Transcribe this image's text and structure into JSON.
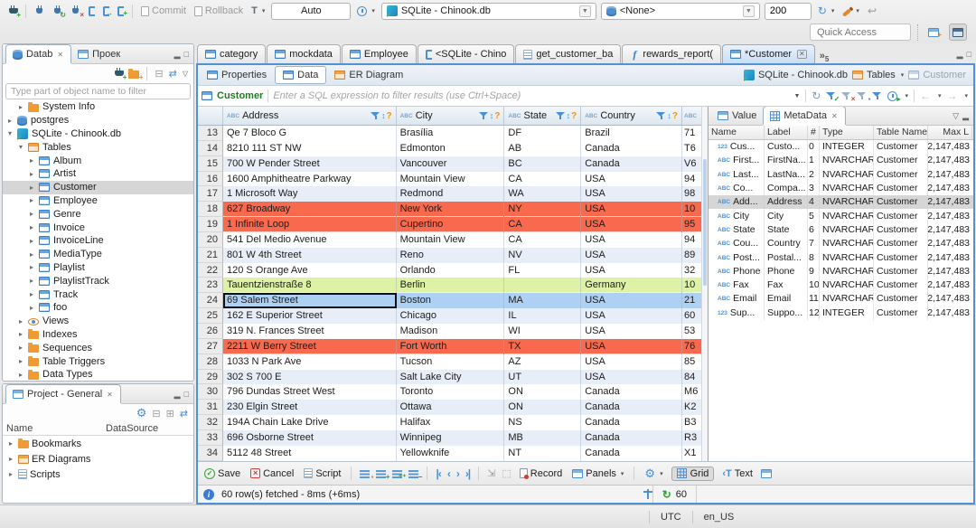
{
  "window": {
    "quick_access_placeholder": "Quick Access",
    "statusbar": {
      "timezone": "UTC",
      "locale": "en_US"
    }
  },
  "toolbar": {
    "commit_label": "Commit",
    "rollback_label": "Rollback",
    "tx_mode": "Auto",
    "connection": "SQLite - Chinook.db",
    "schema": "<None>",
    "fetch_size": "200"
  },
  "sidebar": {
    "tabs": [
      "Datab",
      "Проек"
    ],
    "filter_placeholder": "Type part of object name to filter",
    "tree": [
      {
        "label": "System Info",
        "icon": "folder",
        "indent": 1,
        "expanded": false
      },
      {
        "label": "postgres",
        "icon": "db",
        "indent": 0,
        "expanded": false
      },
      {
        "label": "SQLite - Chinook.db",
        "icon": "dbg",
        "indent": 0,
        "expanded": true
      },
      {
        "label": "Tables",
        "icon": "ftable",
        "indent": 1,
        "expanded": true
      },
      {
        "label": "Album",
        "icon": "table",
        "indent": 2,
        "expanded": false
      },
      {
        "label": "Artist",
        "icon": "table",
        "indent": 2,
        "expanded": false
      },
      {
        "label": "Customer",
        "icon": "table",
        "indent": 2,
        "expanded": false,
        "selected": true
      },
      {
        "label": "Employee",
        "icon": "table",
        "indent": 2,
        "expanded": false
      },
      {
        "label": "Genre",
        "icon": "table",
        "indent": 2,
        "expanded": false
      },
      {
        "label": "Invoice",
        "icon": "table",
        "indent": 2,
        "expanded": false
      },
      {
        "label": "InvoiceLine",
        "icon": "table",
        "indent": 2,
        "expanded": false
      },
      {
        "label": "MediaType",
        "icon": "table",
        "indent": 2,
        "expanded": false
      },
      {
        "label": "Playlist",
        "icon": "table",
        "indent": 2,
        "expanded": false
      },
      {
        "label": "PlaylistTrack",
        "icon": "table",
        "indent": 2,
        "expanded": false
      },
      {
        "label": "Track",
        "icon": "table",
        "indent": 2,
        "expanded": false
      },
      {
        "label": "foo",
        "icon": "table",
        "indent": 2,
        "expanded": false
      },
      {
        "label": "Views",
        "icon": "eye",
        "indent": 1,
        "expanded": false
      },
      {
        "label": "Indexes",
        "icon": "folder",
        "indent": 1,
        "expanded": false
      },
      {
        "label": "Sequences",
        "icon": "folder",
        "indent": 1,
        "expanded": false
      },
      {
        "label": "Table Triggers",
        "icon": "folder",
        "indent": 1,
        "expanded": false
      },
      {
        "label": "Data Types",
        "icon": "folder",
        "indent": 1,
        "expanded": false
      }
    ]
  },
  "project_panel": {
    "title": "Project - General",
    "columns": {
      "name": "Name",
      "datasource": "DataSource"
    },
    "items": [
      {
        "label": "Bookmarks",
        "icon": "folder"
      },
      {
        "label": "ER Diagrams",
        "icon": "ftable"
      },
      {
        "label": "Scripts",
        "icon": "script"
      }
    ]
  },
  "editor": {
    "tabs": [
      {
        "label": "category",
        "icon": "table",
        "active": false
      },
      {
        "label": "mockdata",
        "icon": "table",
        "active": false
      },
      {
        "label": "Employee",
        "icon": "table",
        "active": false
      },
      {
        "label": "<SQLite - Chino",
        "icon": "sql",
        "active": false
      },
      {
        "label": "get_customer_ba",
        "icon": "script",
        "active": false
      },
      {
        "label": "rewards_report(",
        "icon": "func",
        "active": false
      },
      {
        "label": "*Customer",
        "icon": "table",
        "active": true,
        "closable": true
      }
    ],
    "more_tabs": "5",
    "result_tabs": [
      {
        "label": "Properties",
        "icon": "table",
        "active": false
      },
      {
        "label": "Data",
        "icon": "data",
        "active": true
      },
      {
        "label": "ER Diagram",
        "icon": "er",
        "active": false
      }
    ],
    "breadcrumb": [
      {
        "label": "SQLite - Chinook.db",
        "icon": "dbg",
        "dropdown": false,
        "muted": false
      },
      {
        "label": "Tables",
        "icon": "ftable",
        "dropdown": true,
        "muted": false
      },
      {
        "label": "Customer",
        "icon": "table",
        "dropdown": false,
        "muted": true
      }
    ]
  },
  "filter_bar": {
    "table": "Customer",
    "placeholder": "Enter a SQL expression to filter results (use Ctrl+Space)"
  },
  "grid": {
    "columns": [
      "Address",
      "City",
      "State",
      "Country"
    ],
    "rows": [
      {
        "num": "13",
        "cells": [
          "Qe 7 Bloco G",
          "Brasília",
          "DF",
          "Brazil",
          "71"
        ],
        "bg": "white"
      },
      {
        "num": "14",
        "cells": [
          "8210 111 ST NW",
          "Edmonton",
          "AB",
          "Canada",
          "T6"
        ],
        "bg": "white"
      },
      {
        "num": "15",
        "cells": [
          "700 W Pender Street",
          "Vancouver",
          "BC",
          "Canada",
          "V6"
        ],
        "bg": "stripe"
      },
      {
        "num": "16",
        "cells": [
          "1600 Amphitheatre Parkway",
          "Mountain View",
          "CA",
          "USA",
          "94"
        ],
        "bg": "white"
      },
      {
        "num": "17",
        "cells": [
          "1 Microsoft Way",
          "Redmond",
          "WA",
          "USA",
          "98"
        ],
        "bg": "stripe"
      },
      {
        "num": "18",
        "cells": [
          "627 Broadway",
          "New York",
          "NY",
          "USA",
          "10"
        ],
        "bg": "red"
      },
      {
        "num": "19",
        "cells": [
          "1 Infinite Loop",
          "Cupertino",
          "CA",
          "USA",
          "95"
        ],
        "bg": "red"
      },
      {
        "num": "20",
        "cells": [
          "541 Del Medio Avenue",
          "Mountain View",
          "CA",
          "USA",
          "94"
        ],
        "bg": "white"
      },
      {
        "num": "21",
        "cells": [
          "801 W 4th Street",
          "Reno",
          "NV",
          "USA",
          "89"
        ],
        "bg": "stripe"
      },
      {
        "num": "22",
        "cells": [
          "120 S Orange Ave",
          "Orlando",
          "FL",
          "USA",
          "32"
        ],
        "bg": "white"
      },
      {
        "num": "23",
        "cells": [
          "Tauentzienstraße 8",
          "Berlin",
          "",
          "Germany",
          "10"
        ],
        "bg": "green"
      },
      {
        "num": "24",
        "cells": [
          "69 Salem Street",
          "Boston",
          "MA",
          "USA",
          "21"
        ],
        "bg": "selected",
        "focus_col": 0
      },
      {
        "num": "25",
        "cells": [
          "162 E Superior Street",
          "Chicago",
          "IL",
          "USA",
          "60"
        ],
        "bg": "stripe"
      },
      {
        "num": "26",
        "cells": [
          "319 N. Frances Street",
          "Madison",
          "WI",
          "USA",
          "53"
        ],
        "bg": "white"
      },
      {
        "num": "27",
        "cells": [
          "2211 W Berry Street",
          "Fort Worth",
          "TX",
          "USA",
          "76"
        ],
        "bg": "red"
      },
      {
        "num": "28",
        "cells": [
          "1033 N Park Ave",
          "Tucson",
          "AZ",
          "USA",
          "85"
        ],
        "bg": "white"
      },
      {
        "num": "29",
        "cells": [
          "302 S 700 E",
          "Salt Lake City",
          "UT",
          "USA",
          "84"
        ],
        "bg": "stripe"
      },
      {
        "num": "30",
        "cells": [
          "796 Dundas Street West",
          "Toronto",
          "ON",
          "Canada",
          "M6"
        ],
        "bg": "white"
      },
      {
        "num": "31",
        "cells": [
          "230 Elgin Street",
          "Ottawa",
          "ON",
          "Canada",
          "K2"
        ],
        "bg": "stripe"
      },
      {
        "num": "32",
        "cells": [
          "194A Chain Lake Drive",
          "Halifax",
          "NS",
          "Canada",
          "B3"
        ],
        "bg": "white"
      },
      {
        "num": "33",
        "cells": [
          "696 Osborne Street",
          "Winnipeg",
          "MB",
          "Canada",
          "R3"
        ],
        "bg": "stripe"
      },
      {
        "num": "34",
        "cells": [
          "5112 48 Street",
          "Yellowknife",
          "NT",
          "Canada",
          "X1"
        ],
        "bg": "white"
      }
    ]
  },
  "metadata_panel": {
    "tabs": [
      "Value",
      "MetaData"
    ],
    "columns": [
      "Name",
      "Label",
      "#",
      "Type",
      "Table Name",
      "Max L"
    ],
    "rows": [
      {
        "icon": "123",
        "name": "Cus...",
        "label": "Custo...",
        "num": "0",
        "type": "INTEGER",
        "table": "Customer",
        "max": "2,147,483",
        "selected": false
      },
      {
        "icon": "abc",
        "name": "First...",
        "label": "FirstNa...",
        "num": "1",
        "type": "NVARCHAR",
        "table": "Customer",
        "max": "2,147,483",
        "selected": false
      },
      {
        "icon": "abc",
        "name": "Last...",
        "label": "LastNa...",
        "num": "2",
        "type": "NVARCHAR",
        "table": "Customer",
        "max": "2,147,483",
        "selected": false
      },
      {
        "icon": "abc",
        "name": "Co...",
        "label": "Compa...",
        "num": "3",
        "type": "NVARCHAR",
        "table": "Customer",
        "max": "2,147,483",
        "selected": false
      },
      {
        "icon": "abc",
        "name": "Add...",
        "label": "Address",
        "num": "4",
        "type": "NVARCHAR",
        "table": "Customer",
        "max": "2,147,483",
        "selected": true
      },
      {
        "icon": "abc",
        "name": "City",
        "label": "City",
        "num": "5",
        "type": "NVARCHAR",
        "table": "Customer",
        "max": "2,147,483",
        "selected": false
      },
      {
        "icon": "abc",
        "name": "State",
        "label": "State",
        "num": "6",
        "type": "NVARCHAR",
        "table": "Customer",
        "max": "2,147,483",
        "selected": false
      },
      {
        "icon": "abc",
        "name": "Cou...",
        "label": "Country",
        "num": "7",
        "type": "NVARCHAR",
        "table": "Customer",
        "max": "2,147,483",
        "selected": false
      },
      {
        "icon": "abc",
        "name": "Post...",
        "label": "Postal...",
        "num": "8",
        "type": "NVARCHAR",
        "table": "Customer",
        "max": "2,147,483",
        "selected": false
      },
      {
        "icon": "abc",
        "name": "Phone",
        "label": "Phone",
        "num": "9",
        "type": "NVARCHAR",
        "table": "Customer",
        "max": "2,147,483",
        "selected": false
      },
      {
        "icon": "abc",
        "name": "Fax",
        "label": "Fax",
        "num": "10",
        "type": "NVARCHAR",
        "table": "Customer",
        "max": "2,147,483",
        "selected": false
      },
      {
        "icon": "abc",
        "name": "Email",
        "label": "Email",
        "num": "11",
        "type": "NVARCHAR",
        "table": "Customer",
        "max": "2,147,483",
        "selected": false
      },
      {
        "icon": "123",
        "name": "Sup...",
        "label": "Suppo...",
        "num": "12",
        "type": "INTEGER",
        "table": "Customer",
        "max": "2,147,483",
        "selected": false
      }
    ]
  },
  "bottom_toolbar": {
    "save": "Save",
    "cancel": "Cancel",
    "script": "Script",
    "record": "Record",
    "panels": "Panels",
    "grid": "Grid",
    "text": "Text"
  },
  "status": {
    "fetch_text": "60 row(s) fetched - 8ms (+6ms)",
    "refresh_value": "60"
  },
  "colors": {
    "accent": "#4f93d6",
    "row_white": "#ffffff",
    "row_stripe": "#e8eef7",
    "row_red": "#f9694d",
    "row_green": "#ddf2a4",
    "row_selected": "#aed0f2"
  }
}
